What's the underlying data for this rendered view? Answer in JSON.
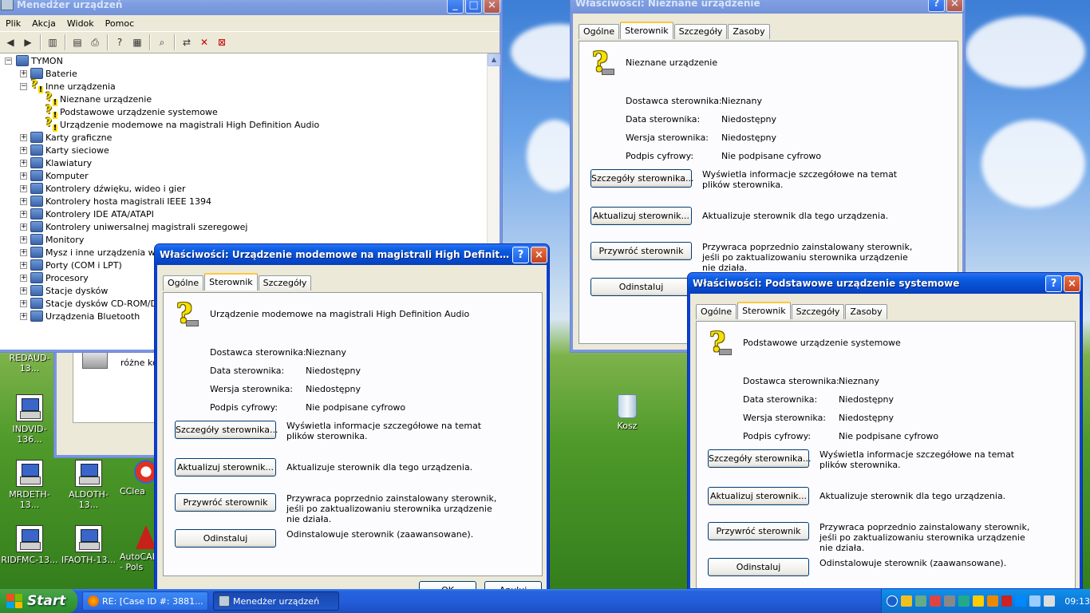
{
  "desktop": {
    "icons": [
      {
        "label": "REDAUD-13..."
      },
      {
        "label": "INDVID-136..."
      },
      {
        "label": "MRDETH-13..."
      },
      {
        "label": "ALDOTH-13..."
      },
      {
        "label": "CClea"
      },
      {
        "label": "RIDFMC-13..."
      },
      {
        "label": "IFAOTH-13..."
      },
      {
        "label": "AutoCAD"
      },
      {
        "label": "- Pols"
      },
      {
        "label": "Kosz"
      }
    ]
  },
  "device_manager": {
    "title": "Menedżer urządzeń",
    "menu": [
      "Plik",
      "Akcja",
      "Widok",
      "Pomoc"
    ],
    "tree": {
      "root": "TYMON",
      "items": [
        {
          "label": "Baterie",
          "level": 1,
          "expander": "+"
        },
        {
          "label": "Inne urządzenia",
          "level": 1,
          "expander": "−"
        },
        {
          "label": "Nieznane urządzenie",
          "level": 2
        },
        {
          "label": "Podstawowe urządzenie systemowe",
          "level": 2
        },
        {
          "label": "Urządzenie modemowe na magistrali High Definition Audio",
          "level": 2
        },
        {
          "label": "Karty graficzne",
          "level": 1,
          "expander": "+"
        },
        {
          "label": "Karty sieciowe",
          "level": 1,
          "expander": "+"
        },
        {
          "label": "Klawiatury",
          "level": 1,
          "expander": "+"
        },
        {
          "label": "Komputer",
          "level": 1,
          "expander": "+"
        },
        {
          "label": "Kontrolery dźwięku, wideo i gier",
          "level": 1,
          "expander": "+"
        },
        {
          "label": "Kontrolery hosta magistrali IEEE 1394",
          "level": 1,
          "expander": "+"
        },
        {
          "label": "Kontrolery IDE ATA/ATAPI",
          "level": 1,
          "expander": "+"
        },
        {
          "label": "Kontrolery uniwersalnej magistrali szeregowej",
          "level": 1,
          "expander": "+"
        },
        {
          "label": "Monitory",
          "level": 1,
          "expander": "+"
        },
        {
          "label": "Mysz i inne urządzenia wskaz",
          "level": 1,
          "expander": "+"
        },
        {
          "label": "Porty (COM i LPT)",
          "level": 1,
          "expander": "+"
        },
        {
          "label": "Procesory",
          "level": 1,
          "expander": "+"
        },
        {
          "label": "Stacje dysków",
          "level": 1,
          "expander": "+"
        },
        {
          "label": "Stacje dysków CD-ROM/DVD",
          "level": 1,
          "expander": "+"
        },
        {
          "label": "Urządzenia Bluetooth",
          "level": 1,
          "expander": "+"
        }
      ]
    }
  },
  "behind_window": {
    "text": "różne kon"
  },
  "dialog_unknown": {
    "title": "Właściwości: Nieznane urządzenie",
    "tabs": [
      "Ogólne",
      "Sterownik",
      "Szczegóły",
      "Zasoby"
    ],
    "device_name": "Nieznane urządzenie",
    "fields": [
      {
        "label": "Dostawca sterownika:",
        "value": "Nieznany"
      },
      {
        "label": "Data sterownika:",
        "value": "Niedostępny"
      },
      {
        "label": "Wersja sterownika:",
        "value": "Niedostępny"
      },
      {
        "label": "Podpis cyfrowy:",
        "value": "Nie podpisane cyfrowo"
      }
    ],
    "buttons": [
      {
        "label": "Szczegóły sterownika...",
        "desc": "Wyświetla informacje szczegółowe na temat plików sterownika."
      },
      {
        "label": "Aktualizuj sterownik...",
        "desc": "Aktualizuje sterownik dla tego urządzenia."
      },
      {
        "label": "Przywróć sterownik",
        "desc": "Przywraca poprzednio zainstalowany sterownik, jeśli po zaktualizowaniu sterownika urządzenie nie działa."
      },
      {
        "label": "Odinstaluj",
        "desc": ""
      }
    ]
  },
  "dialog_modem": {
    "title": "Właściwości: Urządzenie modemowe na magistrali High Definition A...",
    "tabs": [
      "Ogólne",
      "Sterownik",
      "Szczegóły"
    ],
    "device_name": "Urządzenie modemowe na magistrali High Definition Audio",
    "fields": [
      {
        "label": "Dostawca sterownika:",
        "value": "Nieznany"
      },
      {
        "label": "Data sterownika:",
        "value": "Niedostępny"
      },
      {
        "label": "Wersja sterownika:",
        "value": "Niedostępny"
      },
      {
        "label": "Podpis cyfrowy:",
        "value": "Nie podpisane cyfrowo"
      }
    ],
    "buttons": [
      {
        "label": "Szczegóły sterownika...",
        "desc": "Wyświetla informacje szczegółowe na temat plików sterownika."
      },
      {
        "label": "Aktualizuj sterownik...",
        "desc": "Aktualizuje sterownik dla tego urządzenia."
      },
      {
        "label": "Przywróć sterownik",
        "desc": "Przywraca poprzednio zainstalowany sterownik, jeśli po zaktualizowaniu sterownika urządzenie nie działa."
      },
      {
        "label": "Odinstaluj",
        "desc": "Odinstalowuje sterownik (zaawansowane)."
      }
    ],
    "ok": "OK",
    "cancel": "Anuluj"
  },
  "dialog_system": {
    "title": "Właściwości: Podstawowe urządzenie systemowe",
    "tabs": [
      "Ogólne",
      "Sterownik",
      "Szczegóły",
      "Zasoby"
    ],
    "device_name": "Podstawowe urządzenie systemowe",
    "fields": [
      {
        "label": "Dostawca sterownika:",
        "value": "Nieznany"
      },
      {
        "label": "Data sterownika:",
        "value": "Niedostępny"
      },
      {
        "label": "Wersja sterownika:",
        "value": "Niedostępny"
      },
      {
        "label": "Podpis cyfrowy:",
        "value": "Nie podpisane cyfrowo"
      }
    ],
    "buttons": [
      {
        "label": "Szczegóły sterownika...",
        "desc": "Wyświetla informacje szczegółowe na temat plików sterownika."
      },
      {
        "label": "Aktualizuj sterownik...",
        "desc": "Aktualizuje sterownik dla tego urządzenia."
      },
      {
        "label": "Przywróć sterownik",
        "desc": "Przywraca poprzednio zainstalowany sterownik, jeśli po zaktualizowaniu sterownika urządzenie nie działa."
      },
      {
        "label": "Odinstaluj",
        "desc": "Odinstalowuje sterownik (zaawansowane)."
      }
    ]
  },
  "taskbar": {
    "start": "Start",
    "tasks": [
      {
        "label": "RE: [Case ID #: 3881...",
        "active": false
      },
      {
        "label": "Menedżer urządzeń",
        "active": true
      }
    ],
    "clock": "09:13"
  },
  "colors": {
    "title_active": "#0a5be0",
    "title_inactive": "#7f9fe3",
    "window_bg": "#ece9d8",
    "start_green": "#389d38"
  }
}
